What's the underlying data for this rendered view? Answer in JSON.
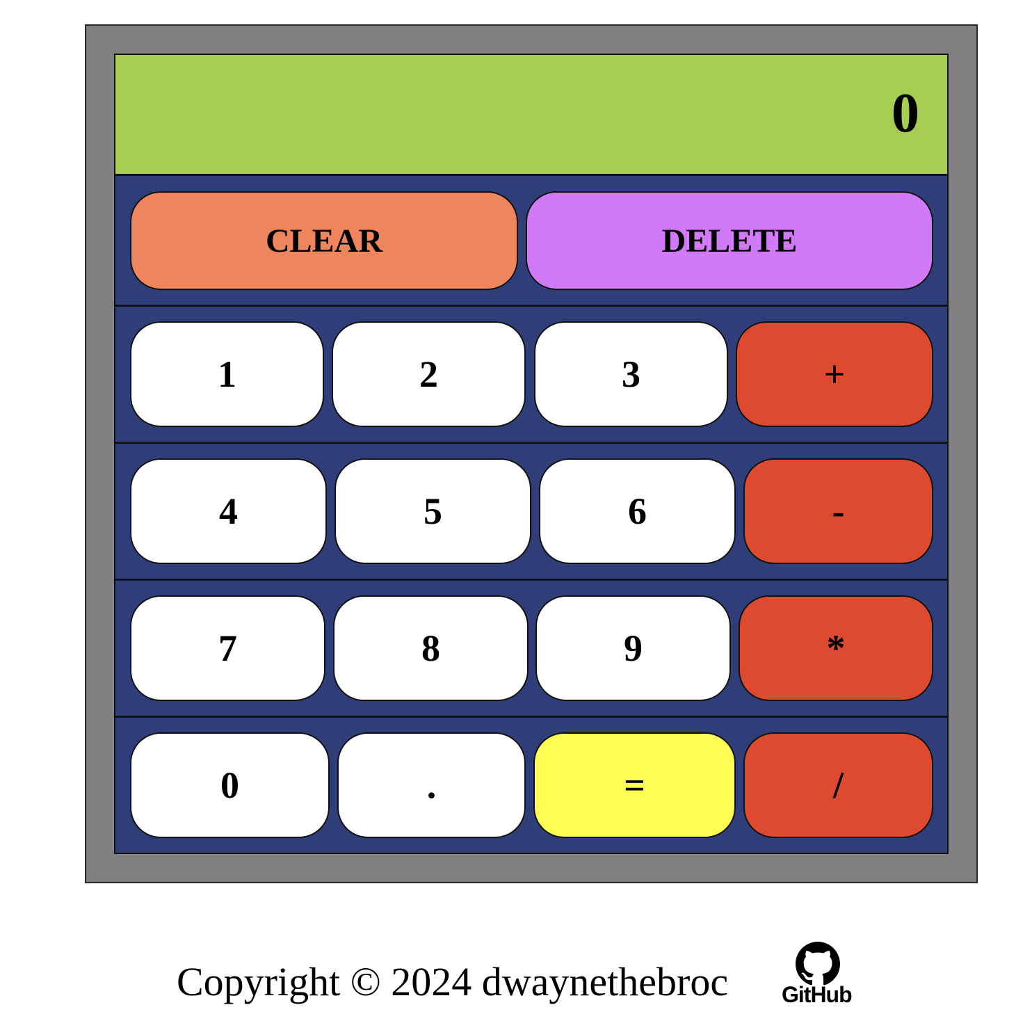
{
  "display": {
    "value": "0"
  },
  "controls": {
    "clear_label": "CLEAR",
    "delete_label": "DELETE"
  },
  "keys": {
    "k1": "1",
    "k2": "2",
    "k3": "3",
    "plus": "+",
    "k4": "4",
    "k5": "5",
    "k6": "6",
    "minus": "-",
    "k7": "7",
    "k8": "8",
    "k9": "9",
    "times": "*",
    "k0": "0",
    "dot": ".",
    "equals": "=",
    "divide": "/"
  },
  "footer": {
    "copyright": "Copyright © 2024 dwaynethebroc",
    "github_label": "GitHub",
    "github_icon": "github-icon"
  },
  "colors": {
    "frame": "#808080",
    "display_bg": "#a6cc52",
    "keypad_bg": "#2f3e78",
    "digit_key": "#ffffff",
    "operator_key": "#de4a30",
    "clear_key": "#ef855d",
    "delete_key": "#d17af8",
    "equals_key": "#fefe54"
  }
}
